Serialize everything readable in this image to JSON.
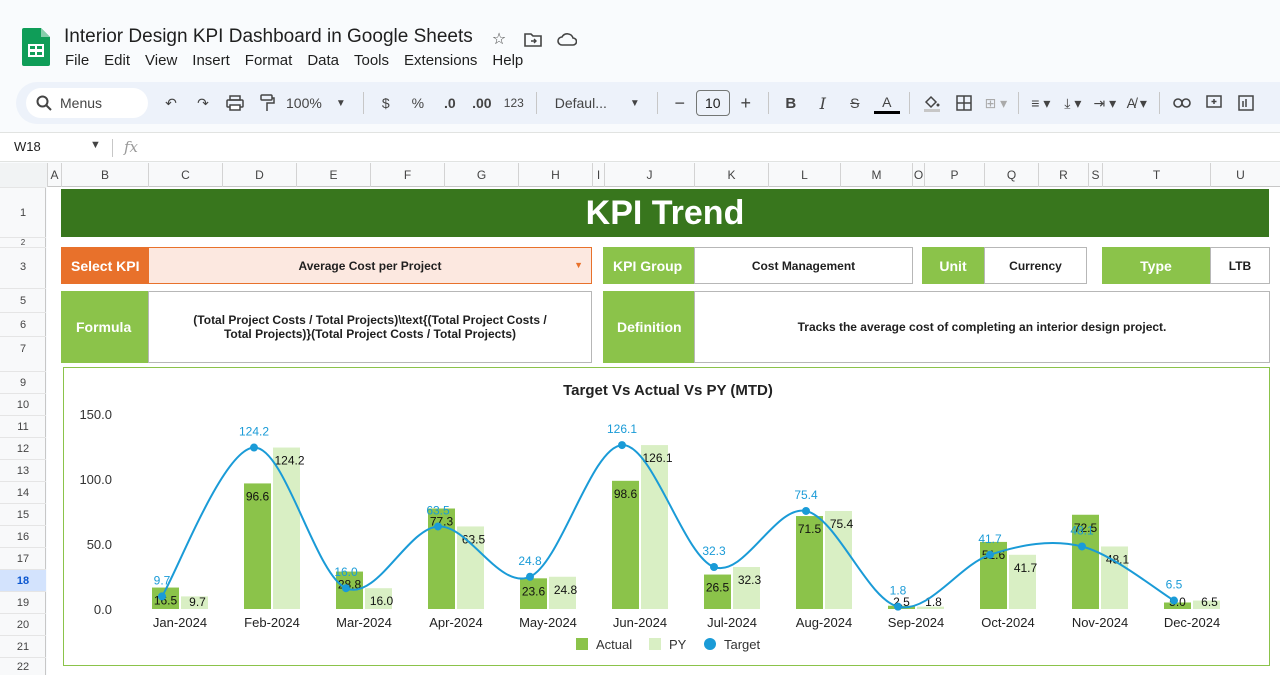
{
  "app": {
    "title": "Interior Design KPI Dashboard in Google Sheets",
    "menu": [
      "File",
      "Edit",
      "View",
      "Insert",
      "Format",
      "Data",
      "Tools",
      "Extensions",
      "Help"
    ]
  },
  "toolbar": {
    "search_label": "Menus",
    "zoom": "100%",
    "currency": "$",
    "percent": "%",
    "decimal_dec": ".0",
    "decimal_inc": ".00",
    "number_format": "123",
    "font": "Defaul...",
    "font_size": "10",
    "bold": "B",
    "italic": "I",
    "strike": "S",
    "text_color": "A"
  },
  "formula_bar": {
    "cell_ref": "W18",
    "fx": "fx"
  },
  "columns": [
    "A",
    "B",
    "C",
    "D",
    "E",
    "F",
    "G",
    "H",
    "I",
    "J",
    "K",
    "L",
    "M",
    "O",
    "P",
    "Q",
    "R",
    "S",
    "T",
    "U"
  ],
  "rows": [
    "1",
    "2",
    "3",
    "5",
    "6",
    "7",
    "9",
    "10",
    "11",
    "12",
    "13",
    "14",
    "15",
    "16",
    "17",
    "18",
    "19",
    "20",
    "21",
    "22"
  ],
  "dashboard": {
    "banner": "KPI Trend",
    "select_kpi_label": "Select KPI",
    "select_kpi_value": "Average Cost per Project",
    "kpi_group_label": "KPI Group",
    "kpi_group_value": "Cost Management",
    "unit_label": "Unit",
    "unit_value": "Currency",
    "type_label": "Type",
    "type_value": "LTB",
    "formula_label": "Formula",
    "formula_value": "(Total Project Costs / Total Projects)\\text{(Total Project Costs / Total Projects)}(Total Project Costs / Total Projects)",
    "definition_label": "Definition",
    "definition_value": "Tracks the average cost of completing an interior design project."
  },
  "colors": {
    "banner": "#38761d",
    "label_green": "#8bc34a",
    "select_orange": "#e8712b",
    "actual": "#8bc34a",
    "py": "#d9efc4",
    "target": "#1a9bd7"
  },
  "chart_data": {
    "type": "bar",
    "title": "Target Vs Actual Vs PY (MTD)",
    "categories": [
      "Jan-2024",
      "Feb-2024",
      "Mar-2024",
      "Apr-2024",
      "May-2024",
      "Jun-2024",
      "Jul-2024",
      "Aug-2024",
      "Sep-2024",
      "Oct-2024",
      "Nov-2024",
      "Dec-2024"
    ],
    "series": [
      {
        "name": "Actual",
        "type": "bar",
        "values": [
          16.5,
          96.6,
          28.8,
          77.3,
          23.6,
          98.6,
          26.5,
          71.5,
          2.5,
          51.6,
          72.5,
          5.0
        ]
      },
      {
        "name": "PY",
        "type": "bar",
        "values": [
          9.7,
          124.2,
          16.0,
          63.5,
          24.8,
          126.1,
          32.3,
          75.4,
          1.8,
          41.7,
          48.1,
          6.5
        ]
      },
      {
        "name": "Target",
        "type": "line",
        "values": [
          9.7,
          124.2,
          16.0,
          63.5,
          24.8,
          126.1,
          32.3,
          75.4,
          1.8,
          41.7,
          48.1,
          6.5
        ]
      }
    ],
    "y_ticks": [
      "0.0",
      "50.0",
      "100.0",
      "150.0"
    ],
    "ylim": [
      0,
      150
    ],
    "legend": "bottom"
  }
}
